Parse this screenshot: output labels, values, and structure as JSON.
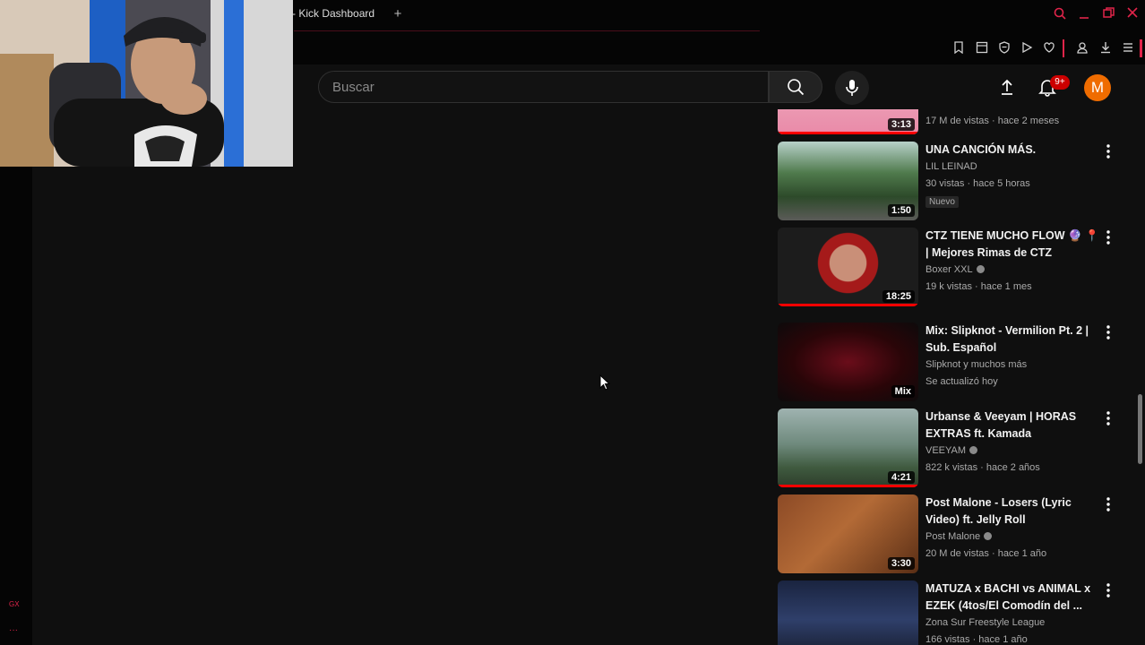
{
  "browser": {
    "tab_title": "- Kick Dashboard",
    "new_tab_symbol": "+",
    "accent": "#e0244a"
  },
  "gx": {
    "logo": "GX",
    "more": "···"
  },
  "header": {
    "search_placeholder": "Buscar",
    "notifications_badge": "9+",
    "avatar_letter": "M",
    "avatar_color": "#ef6c00"
  },
  "videos": [
    {
      "title": "",
      "channel": "",
      "stats": "17 M de vistas · hace 2 meses",
      "duration": "3:13",
      "progress": 1.0
    },
    {
      "title": "UNA CANCIÓN MÁS.",
      "channel": "LIL LEINAD",
      "stats": "30 vistas · hace 5 horas",
      "duration": "1:50",
      "badge": "Nuevo",
      "progress": 0
    },
    {
      "title": "CTZ TIENE MUCHO FLOW 🔮 📍 | Mejores Rimas de CTZ",
      "channel": "Boxer XXL",
      "stats": "19 k vistas · hace 1 mes",
      "duration": "18:25",
      "progress": 1.0,
      "verified": true
    },
    {
      "title": "Mix: Slipknot - Vermilion Pt. 2 | Sub. Español",
      "channel": "Slipknot y muchos más",
      "stats": "Se actualizó hoy",
      "duration": "Mix",
      "progress": 0
    },
    {
      "title": "Urbanse & Veeyam | HORAS EXTRAS ft. Kamada",
      "channel": "VEEYAM",
      "stats": "822 k vistas · hace 2 años",
      "duration": "4:21",
      "progress": 1.0,
      "verified": true
    },
    {
      "title": "Post Malone - Losers (Lyric Video) ft. Jelly Roll",
      "channel": "Post Malone",
      "stats": "20 M de vistas · hace 1 año",
      "duration": "3:30",
      "progress": 0,
      "verified": true
    },
    {
      "title": "MATUZA x BACHI vs ANIMAL x EZEK (4tos/El Comodín del ...",
      "channel": "Zona Sur Freestyle League",
      "stats": "166 vistas · hace 1 año",
      "duration": "",
      "progress": 0
    }
  ]
}
